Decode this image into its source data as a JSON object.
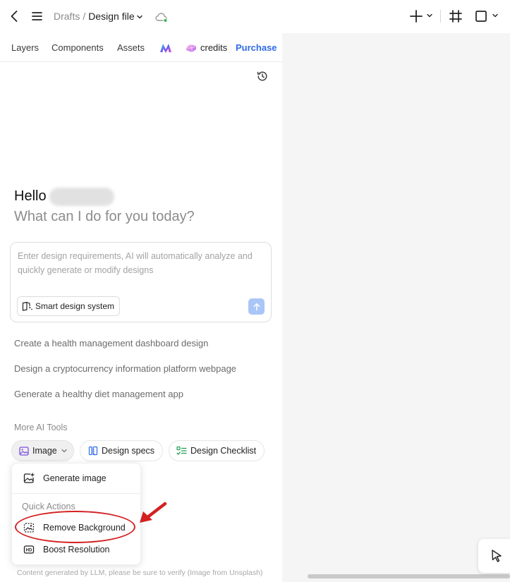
{
  "breadcrumb": {
    "parent": "Drafts",
    "separator": "/",
    "current": "Design file"
  },
  "tabs": {
    "layers": "Layers",
    "components": "Components",
    "assets": "Assets"
  },
  "credits": {
    "label": "credits",
    "purchase": "Purchase"
  },
  "greeting": {
    "hello": "Hello",
    "subtitle": "What can I do for you today?"
  },
  "prompt": {
    "placeholder": "Enter design requirements, AI will automatically analyze and quickly generate or modify designs",
    "smart_design_label": "Smart design system"
  },
  "suggestions": [
    "Create a health management dashboard design",
    "Design a cryptocurrency information platform webpage",
    "Generate a healthy diet management app"
  ],
  "more_ai_tools": {
    "title": "More AI Tools",
    "chips": {
      "image": "Image",
      "design_specs": "Design specs",
      "design_checklist": "Design Checklist"
    }
  },
  "dropdown": {
    "generate_image": "Generate image",
    "quick_actions_title": "Quick Actions",
    "remove_background": "Remove Background",
    "boost_resolution": "Boost Resolution"
  },
  "footer_note": "Content generated by LLM, please be sure to verify (Image from Unsplash)",
  "colors": {
    "accent": "#2f6be6",
    "annotation": "#d42020",
    "send_button": "#a9c6f7",
    "canvas": "#f5f5f5"
  },
  "icons": [
    "back-icon",
    "menu-icon",
    "chevron-down-icon",
    "cloud-sync-icon",
    "plus-icon",
    "frame-icon",
    "rectangle-icon",
    "ai-logo-icon",
    "credits-gem-icon",
    "history-icon",
    "smart-design-icon",
    "arrow-up-icon",
    "image-icon",
    "design-specs-icon",
    "checklist-icon",
    "generate-image-icon",
    "remove-background-icon",
    "hd-icon",
    "cursor-icon"
  ]
}
